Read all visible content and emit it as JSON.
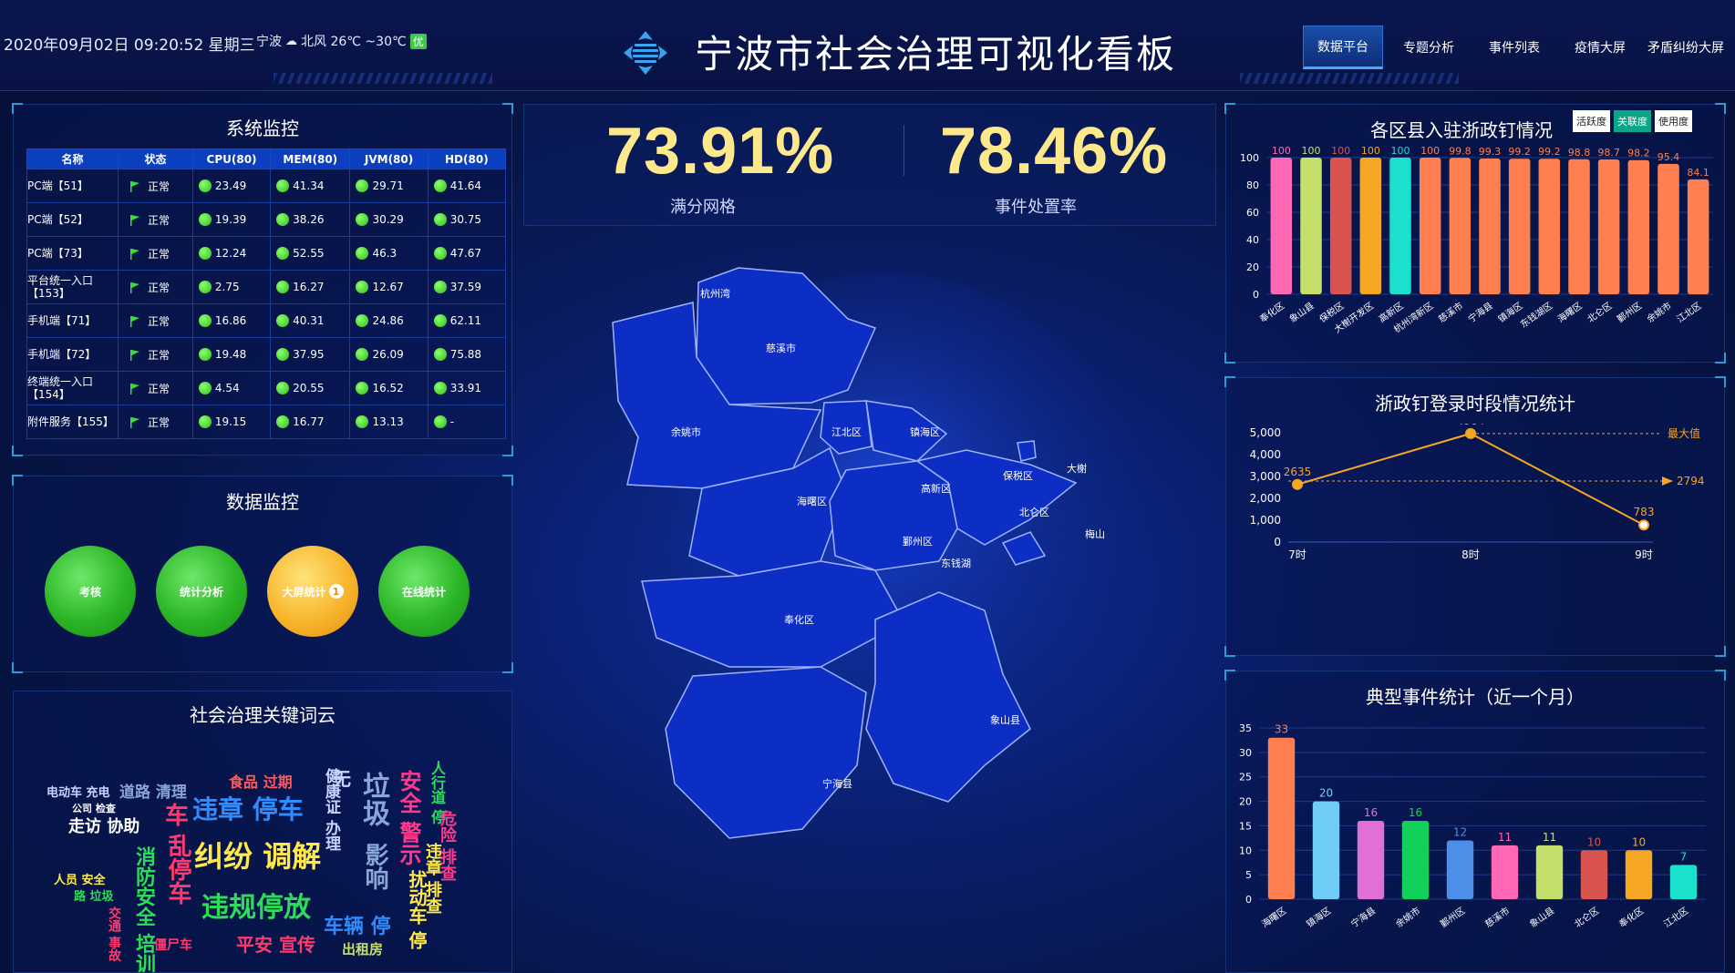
{
  "header": {
    "datetime": "2020年09月02日 09:20:52 星期三",
    "city": "宁波",
    "weather": "北风 26℃ ~30℃",
    "aqi": "优",
    "title": "宁波市社会治理可视化看板",
    "nav": [
      "数据平台",
      "专题分析",
      "事件列表",
      "疫情大屏",
      "矛盾纠纷大屏"
    ],
    "active_tab": "数据平台"
  },
  "system_monitor": {
    "title": "系统监控",
    "columns": [
      "名称",
      "状态",
      "CPU(80)",
      "MEM(80)",
      "JVM(80)",
      "HD(80)"
    ],
    "rows": [
      {
        "name": "PC端【51】",
        "status": "正常",
        "cpu": "23.49",
        "mem": "41.34",
        "jvm": "29.71",
        "hd": "41.64"
      },
      {
        "name": "PC端【52】",
        "status": "正常",
        "cpu": "19.39",
        "mem": "38.26",
        "jvm": "30.29",
        "hd": "30.75"
      },
      {
        "name": "PC端【73】",
        "status": "正常",
        "cpu": "12.24",
        "mem": "52.55",
        "jvm": "46.3",
        "hd": "47.67"
      },
      {
        "name": "平台统一入口【153】",
        "status": "正常",
        "cpu": "2.75",
        "mem": "16.27",
        "jvm": "12.67",
        "hd": "37.59"
      },
      {
        "name": "手机端【71】",
        "status": "正常",
        "cpu": "16.86",
        "mem": "40.31",
        "jvm": "24.86",
        "hd": "62.11"
      },
      {
        "name": "手机端【72】",
        "status": "正常",
        "cpu": "19.48",
        "mem": "37.95",
        "jvm": "26.09",
        "hd": "75.88"
      },
      {
        "name": "终端统一入口【154】",
        "status": "正常",
        "cpu": "4.54",
        "mem": "20.55",
        "jvm": "16.52",
        "hd": "33.91"
      },
      {
        "name": "附件服务【155】",
        "status": "正常",
        "cpu": "19.15",
        "mem": "16.77",
        "jvm": "13.13",
        "hd": "-"
      }
    ]
  },
  "data_monitor": {
    "title": "数据监控",
    "buttons": [
      {
        "label": "考核",
        "color": "green"
      },
      {
        "label": "统计分析",
        "color": "green"
      },
      {
        "label": "大屏统计",
        "color": "yellow",
        "badge": "1"
      },
      {
        "label": "在线统计",
        "color": "green"
      }
    ]
  },
  "word_cloud": {
    "title": "社会治理关键词云",
    "words": [
      "违章 停车",
      "纠纷 调解",
      "违规停放",
      "垃圾",
      "安全 警示",
      "乱停车",
      "食品 过期",
      "消防安全 培训",
      "平安 宣传",
      "车辆 停",
      "走访 协助",
      "电动车 充电",
      "道路 清理",
      "人员 安全",
      "影响",
      "车",
      "出租房",
      "僵尸车",
      "公司 检查",
      "路 垃圾",
      "违章 排查",
      "人行道 停",
      "健康证 办理",
      "交通 事故",
      "扰动车 停",
      "危险 排查",
      "无",
      "路 垃圾"
    ]
  },
  "kpis": [
    {
      "value": "73.91%",
      "label": "满分网格"
    },
    {
      "value": "78.46%",
      "label": "事件处置率"
    }
  ],
  "map": {
    "regions": [
      "杭州湾",
      "慈溪市",
      "余姚市",
      "江北区",
      "镇海区",
      "海曙区",
      "高新区",
      "保税区",
      "大榭",
      "北仑区",
      "鄞州区",
      "东钱湖",
      "梅山",
      "奉化区",
      "象山县",
      "宁海县"
    ]
  },
  "district_chart": {
    "title": "各区县入驻浙政钉情况",
    "toggles": [
      "活跃度",
      "关联度",
      "使用度"
    ],
    "active_toggle": "关联度"
  },
  "login_chart": {
    "title": "浙政钉登录时段情况统计",
    "max_label": "最大值"
  },
  "event_chart": {
    "title": "典型事件统计（近一个月）"
  },
  "chart_data": [
    {
      "type": "bar",
      "title": "各区县入驻浙政钉情况",
      "categories": [
        "奉化区",
        "象山县",
        "保税区",
        "大榭开发区",
        "高新区",
        "杭州湾新区",
        "慈溪市",
        "宁海县",
        "镇海区",
        "东钱湖区",
        "海曙区",
        "北仑区",
        "鄞州区",
        "余姚市",
        "江北区"
      ],
      "values": [
        100,
        100,
        100,
        100,
        100,
        100,
        99.8,
        99.3,
        99.2,
        99.2,
        98.8,
        98.7,
        98.2,
        95.4,
        84.1
      ],
      "colors": [
        "#ff69b4",
        "#c5e06a",
        "#d9534f",
        "#f5a623",
        "#1be0cc",
        "#ff7f50",
        "#ff7f50",
        "#ff7f50",
        "#ff7f50",
        "#ff7f50",
        "#ff7f50",
        "#ff7f50",
        "#ff7f50",
        "#ff7f50",
        "#ff7f50"
      ],
      "ylim": [
        0,
        100
      ],
      "yticks": [
        0,
        20,
        40,
        60,
        80,
        100
      ]
    },
    {
      "type": "line",
      "title": "浙政钉登录时段情况统计",
      "categories": [
        "7时",
        "8时",
        "9时"
      ],
      "values": [
        2635,
        4964,
        783
      ],
      "average": 2794,
      "max_value": 4964,
      "ylim": [
        0,
        5000
      ],
      "yticks": [
        "0",
        "1,000",
        "2,000",
        "3,000",
        "4,000",
        "5,000"
      ]
    },
    {
      "type": "bar",
      "title": "典型事件统计（近一个月）",
      "categories": [
        "海曙区",
        "镇海区",
        "宁海县",
        "余姚市",
        "鄞州区",
        "慈溪市",
        "象山县",
        "北仑区",
        "奉化区",
        "江北区"
      ],
      "values": [
        33,
        20,
        16,
        16,
        12,
        11,
        11,
        10,
        10,
        7
      ],
      "colors": [
        "#ff7f50",
        "#6fcdf8",
        "#e06fd6",
        "#13d05a",
        "#4b8fe8",
        "#ff66b3",
        "#c5e06a",
        "#d9534f",
        "#f5a623",
        "#1be0cc"
      ],
      "ylim": [
        0,
        35
      ],
      "yticks": [
        0,
        5,
        10,
        15,
        20,
        25,
        30,
        35
      ]
    }
  ]
}
